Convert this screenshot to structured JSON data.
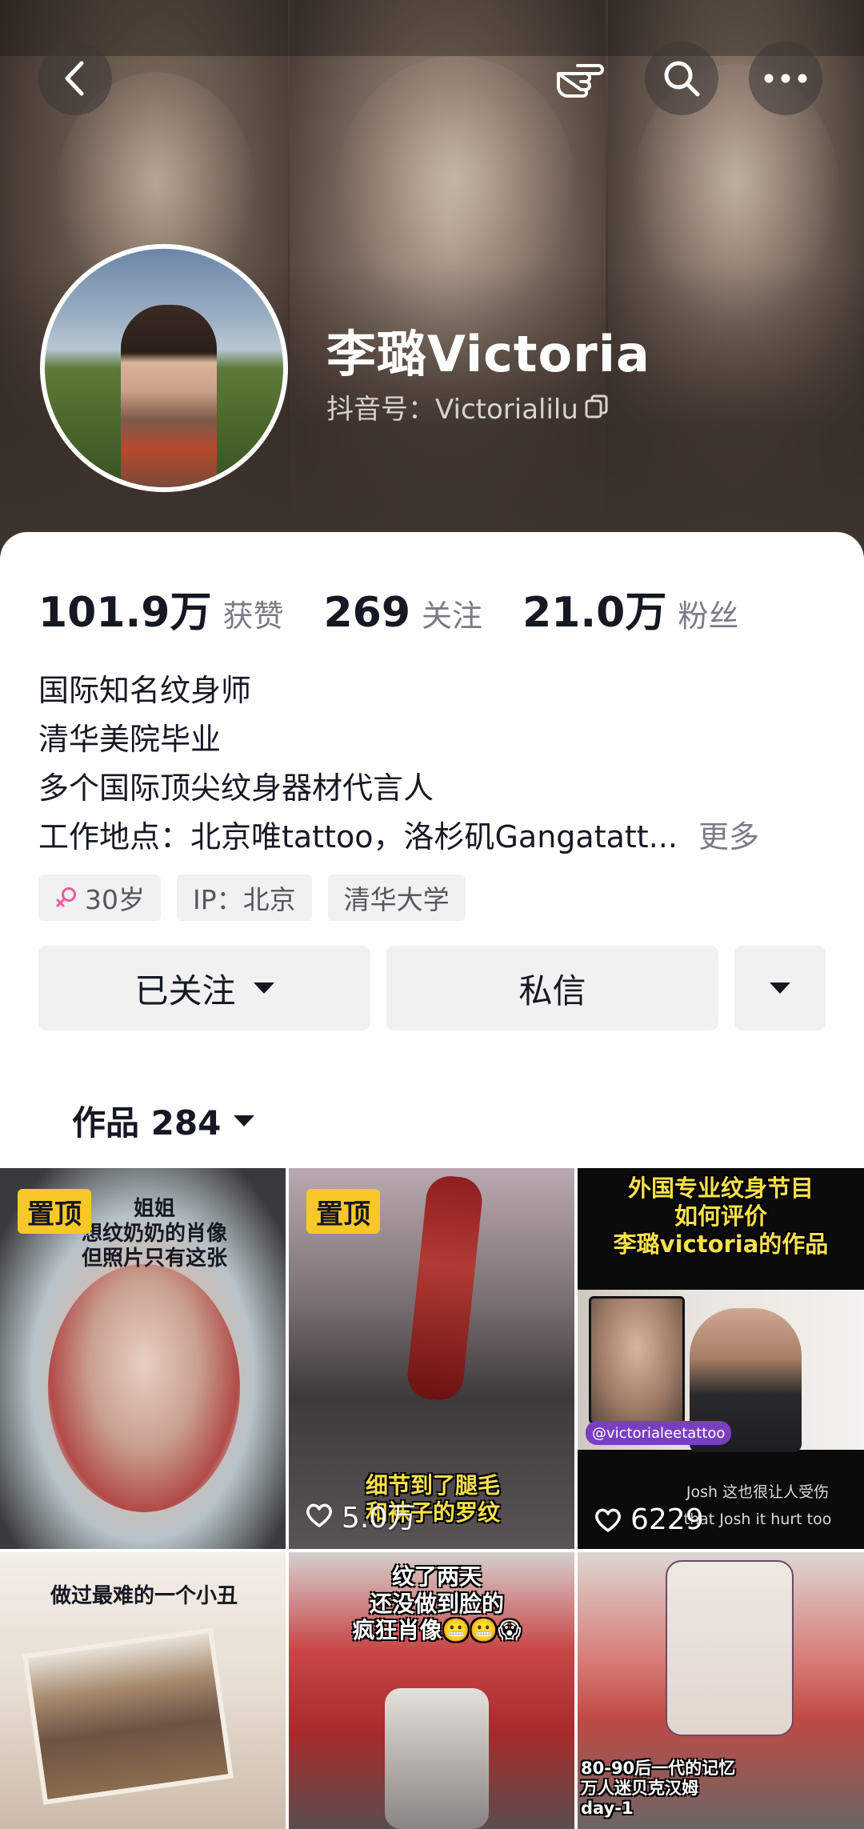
{
  "header": {
    "name": "李璐Victoria",
    "douyin_id": "抖音号：Victorialilu"
  },
  "stats": [
    {
      "value": "101.9万",
      "label": "获赞"
    },
    {
      "value": "269",
      "label": "关注"
    },
    {
      "value": "21.0万",
      "label": "粉丝"
    }
  ],
  "bio": {
    "lines": [
      "国际知名纹身师",
      "清华美院毕业",
      "多个国际顶尖纹身器材代言人",
      "工作地点：北京唯tattoo，洛杉矶Gangatatt..."
    ],
    "more": "更多"
  },
  "tags": {
    "age": "30岁",
    "ip": "IP：北京",
    "school": "清华大学"
  },
  "actions": {
    "follow_label": "已关注",
    "message_label": "私信"
  },
  "works_tab": {
    "label": "作品 284"
  },
  "videos": [
    {
      "pinned": "置顶",
      "caption": "姐姐\n想纹奶奶的肖像\n但照片只有这张",
      "likes": ""
    },
    {
      "pinned": "置顶",
      "caption": "细节到了腿毛\n和袜子的罗纹",
      "likes": "5.0万"
    },
    {
      "pinned": "",
      "caption": "外国专业纹身节目\n如何评价\n李璐victoria的作品",
      "sub_caption": "Josh 这也很让人受伤",
      "sub_caption_en": "that Josh it hurt too",
      "handle": "@victorialeetattoo",
      "likes": "6229"
    },
    {
      "pinned": "",
      "caption": "做过最难的一个小丑",
      "likes": ""
    },
    {
      "pinned": "",
      "caption": "纹了两天\n还没做到脸的\n疯狂肖像😬😬😱",
      "likes": ""
    },
    {
      "pinned": "",
      "caption": "80-90后一代的记忆\n万人迷贝克汉姆\nday-1",
      "likes": ""
    }
  ],
  "colors": {
    "pin_bg": "#f7c826",
    "caption_yellow": "#f8e04a",
    "text_primary": "#161823",
    "text_secondary": "#7a7c85",
    "chip_bg": "#f1f1f2"
  }
}
